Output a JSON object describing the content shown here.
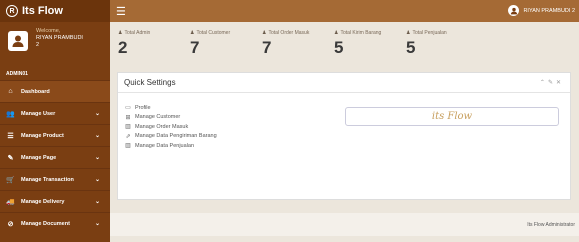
{
  "brand": {
    "logo_text": "R",
    "name": "Its Flow"
  },
  "user": {
    "welcome": "Welcome,",
    "name": "RIYAN PRAMBUDI",
    "line2": "2",
    "role": "ADMIN01"
  },
  "topbar": {
    "user_name": "RIYAN PRAMBUDI 2"
  },
  "menu": [
    {
      "label": "Dashboard",
      "icon": "home-icon",
      "glyph": "⌂",
      "active": true,
      "has_caret": false
    },
    {
      "label": "Manage User",
      "icon": "users-icon",
      "glyph": "👥",
      "active": false,
      "has_caret": true
    },
    {
      "label": "Manage Product",
      "icon": "list-icon",
      "glyph": "☰",
      "active": false,
      "has_caret": true
    },
    {
      "label": "Manage Page",
      "icon": "edit-icon",
      "glyph": "✎",
      "active": false,
      "has_caret": true
    },
    {
      "label": "Manage Transaction",
      "icon": "cart-icon",
      "glyph": "🛒",
      "active": false,
      "has_caret": true
    },
    {
      "label": "Manage Delivery",
      "icon": "truck-icon",
      "glyph": "🚚",
      "active": false,
      "has_caret": true
    },
    {
      "label": "Manage Document",
      "icon": "document-icon",
      "glyph": "⊘",
      "active": false,
      "has_caret": true
    }
  ],
  "stats": [
    {
      "label": "Total Admin",
      "value": "2"
    },
    {
      "label": "Total Customer",
      "value": "7"
    },
    {
      "label": "Total Order Masuk",
      "value": "7"
    },
    {
      "label": "Total Kirim Barang",
      "value": "5"
    },
    {
      "label": "Total Penjualan",
      "value": "5"
    }
  ],
  "panel": {
    "title": "Quick Settings",
    "links": [
      {
        "label": "Profile",
        "icon": "calendar-icon",
        "glyph": "▭"
      },
      {
        "label": "Manage Customer",
        "icon": "grid-icon",
        "glyph": "⊞"
      },
      {
        "label": "Manage Order Masuk",
        "icon": "chart-icon",
        "glyph": "▥"
      },
      {
        "label": "Manage Data Pengiriman Barang",
        "icon": "line-chart-icon",
        "glyph": "⇗"
      },
      {
        "label": "Manage Data Penjualan",
        "icon": "bar-chart-icon",
        "glyph": "▥"
      }
    ],
    "brand_script": "its Flow"
  },
  "footer": {
    "text": "Its Flow Administrator"
  },
  "colors": {
    "sidebar": "#7a3e12",
    "topbar": "#a56a35",
    "accent": "#c8a060"
  }
}
